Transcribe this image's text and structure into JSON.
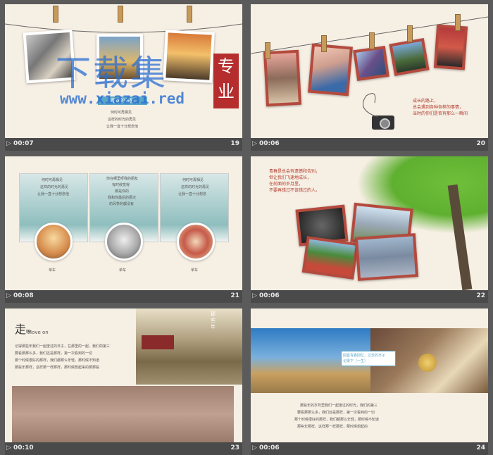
{
  "slides": [
    {
      "time": "00:07",
      "number": "19",
      "lines": [
        "何时可再相见",
        "这样的时光的再见",
        "让我一直十分想念他"
      ],
      "badge": "青春的告别"
    },
    {
      "time": "00:06",
      "number": "20",
      "lines": [
        "成长的路上，",
        "总会遇到各种各样的事情，",
        "当时的你们是否有那么一瞬间"
      ]
    },
    {
      "time": "00:08",
      "number": "21",
      "panels": [
        [
          "何时可再相见",
          "这样的时光的再见",
          "让我一直十分想念他"
        ],
        [
          "你在哪里呀我的朋友",
          "有时候觉得",
          "那是你的",
          "我和你最后的那次",
          "的风筝的都没有"
        ],
        [
          "何时可再相见",
          "这样的时光的再见",
          "让我一直十分想念"
        ]
      ],
      "captions": [
        "单车",
        "单车",
        "单车"
      ]
    },
    {
      "time": "00:06",
      "number": "22",
      "lines": [
        "青春是总会有遗憾和告别，",
        "但让我们飞速地成长，",
        "在前面的岁月里，",
        "不要再错过不该错过的人。"
      ]
    },
    {
      "time": "00:10",
      "number": "23",
      "heading": "走",
      "heading_suffix": "吧",
      "subheading": "Move on",
      "vertical": [
        "那",
        "些",
        "年"
      ],
      "paragraph": [
        "记得那些年我们一起度过的日子，在那里的一起，我们的第三",
        "要看那那么多，我们还是那样，第一次看到的一切",
        "那个时候很好的那样，我们都那么年轻，那时候不知道",
        "那些年那样，这样那一样那样，那时候想起来的那那些"
      ]
    },
    {
      "time": "00:06",
      "number": "24",
      "badge": [
        "回首青春回忆，过去的日子",
        "记录下（一生）"
      ],
      "paragraph": [
        "那些年的岁月里我们一起度过的时光，我们的第三",
        "要看那那么多，我们还是那样，第一次看到的一切",
        "那个时候很好的那样，我们都那么年轻，那时候不知道",
        "那些年那样，这样那一样那样，那时候想起的"
      ]
    }
  ],
  "watermark": {
    "title": "下载集",
    "url": "www.xiazai.red",
    "seal": [
      "专",
      "业"
    ]
  },
  "icons": {
    "play": "▷ play-icon",
    "camera": "camera-icon"
  }
}
